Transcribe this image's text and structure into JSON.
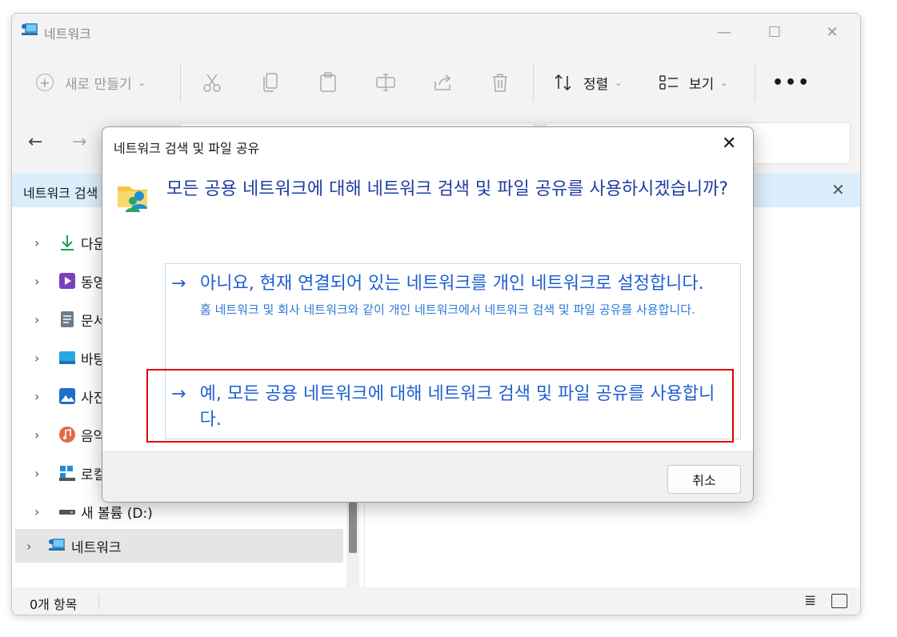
{
  "window": {
    "title": "네트워크",
    "controls": {
      "minimize": "—",
      "maximize": "☐",
      "close": "✕"
    }
  },
  "toolbar": {
    "new_label": "새로 만들기",
    "sort_label": "정렬",
    "view_label": "보기",
    "more": "•••"
  },
  "nav": {
    "back": "←",
    "forward": "→"
  },
  "infobar": {
    "text": "네트워크 검색",
    "close": "✕"
  },
  "sidebar": {
    "items": [
      {
        "label": "다운",
        "icon": "download-icon"
      },
      {
        "label": "동영",
        "icon": "video-icon"
      },
      {
        "label": "문서",
        "icon": "document-icon"
      },
      {
        "label": "바탕",
        "icon": "desktop-icon"
      },
      {
        "label": "사진",
        "icon": "pictures-icon"
      },
      {
        "label": "음악",
        "icon": "music-icon"
      },
      {
        "label": "로컬",
        "icon": "local-disk-icon"
      },
      {
        "label": "새 볼륨 (D:)",
        "icon": "drive-icon"
      }
    ],
    "network_label": "네트워크"
  },
  "statusbar": {
    "count": "0개 항목",
    "details_icon": "≣"
  },
  "dialog": {
    "title": "네트워크 검색 및 파일 공유",
    "close": "✕",
    "heading": "모든 공용 네트워크에 대해 네트워크 검색 및 파일 공유를 사용하시겠습니까?",
    "option_no": {
      "arrow": "→",
      "main": "아니요, 현재 연결되어 있는 네트워크를 개인 네트워크로 설정합니다.",
      "sub": "홈 네트워크 및 회사 네트워크와 같이 개인 네트워크에서 네트워크 검색 및 파일 공유를 사용합니다."
    },
    "option_yes": {
      "arrow": "→",
      "main": "예, 모든 공용 네트워크에 대해 네트워크 검색 및 파일 공유를 사용합니다."
    },
    "cancel_label": "취소"
  },
  "colors": {
    "heading_blue": "#1f3da0",
    "link_blue": "#1f5fd0",
    "highlight_red": "#e00000",
    "infobar_bg": "#dbeefb"
  }
}
